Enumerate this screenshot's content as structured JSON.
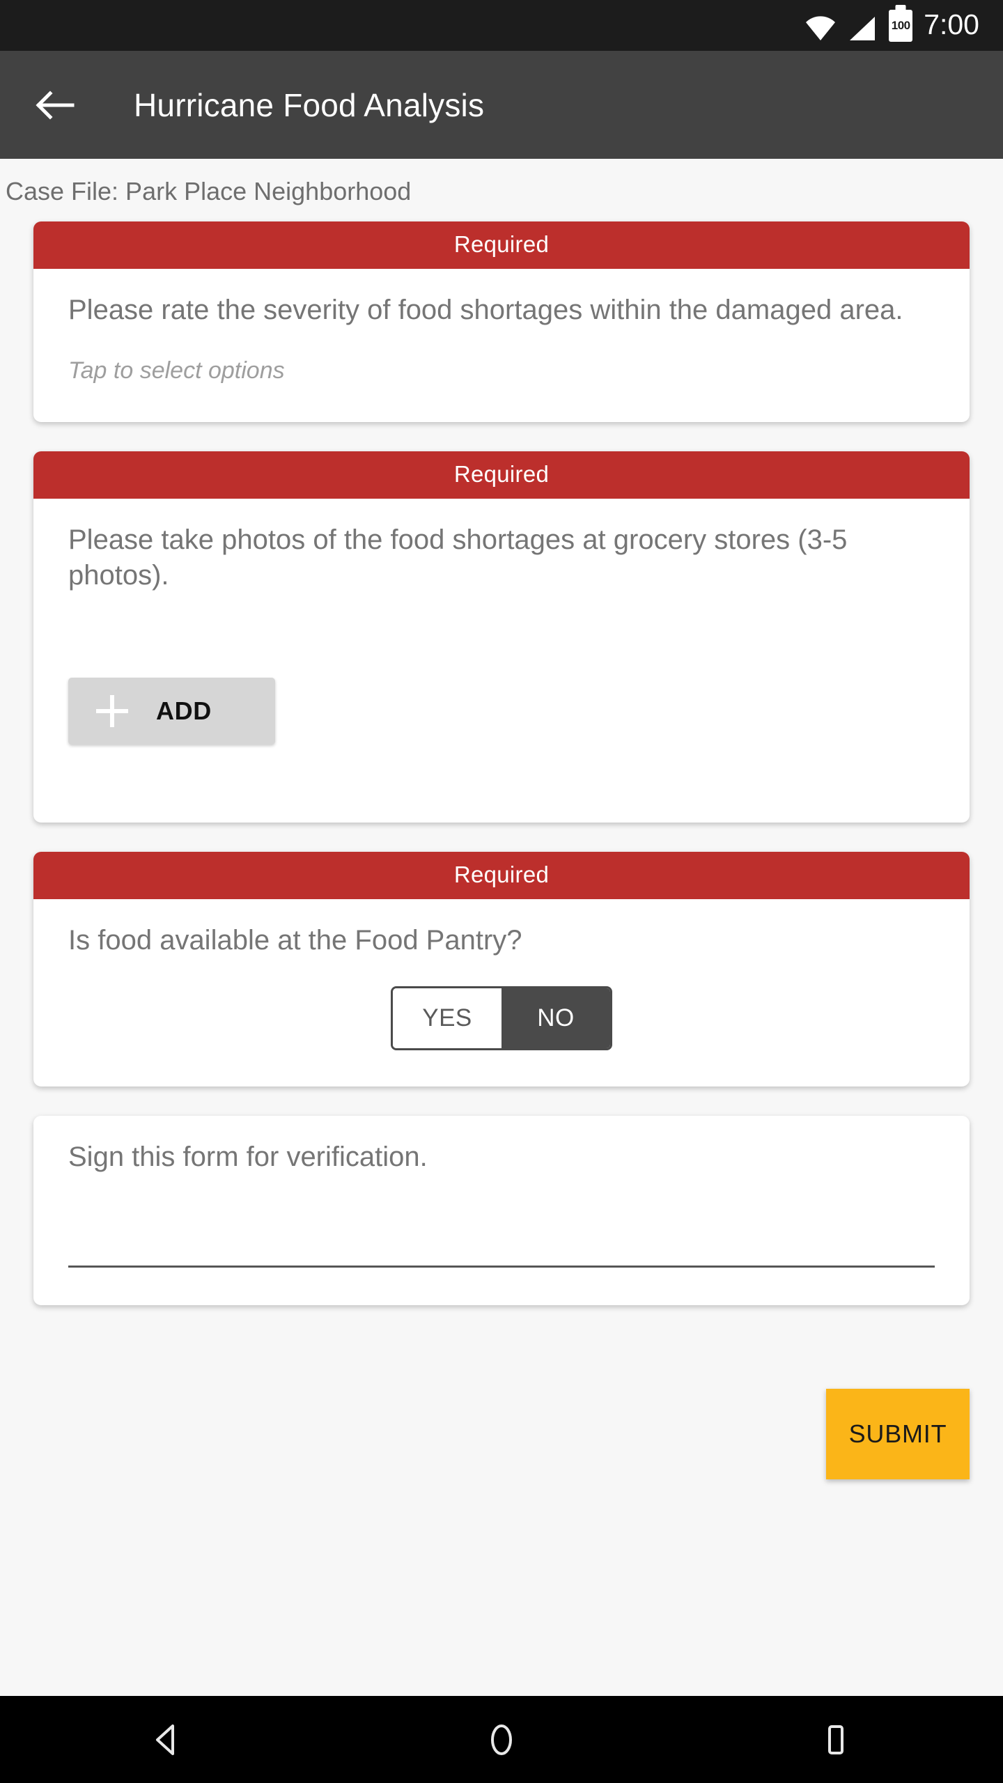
{
  "status_bar": {
    "wifi_icon": "wifi-icon",
    "signal_icon": "cellular-signal-icon",
    "battery_icon": "battery-icon",
    "battery_level": "100",
    "time": "7:00"
  },
  "app_bar": {
    "back_icon": "back-arrow-icon",
    "title": "Hurricane Food Analysis"
  },
  "subtitle": "Case File: Park Place Neighborhood",
  "cards": [
    {
      "banner": "Required",
      "question": "Please rate the severity of food shortages within the damaged area.",
      "hint": "Tap to select options"
    },
    {
      "banner": "Required",
      "question": "Please take photos of the food shortages at grocery stores (3-5 photos).",
      "add_label": "ADD",
      "add_icon": "plus-icon"
    },
    {
      "banner": "Required",
      "question": "Is food available at the Food Pantry?",
      "toggle": {
        "yes_label": "YES",
        "no_label": "NO",
        "selected": "NO"
      }
    },
    {
      "question": "Sign this form for verification."
    }
  ],
  "submit_label": "SUBMIT",
  "nav_bar": {
    "back_icon": "nav-back-triangle-icon",
    "home_icon": "nav-home-circle-icon",
    "recents_icon": "nav-recents-square-icon"
  },
  "colors": {
    "required_red": "#bc2f2c",
    "app_bar_gray": "#424242",
    "submit_amber": "#fbb518",
    "toggle_selected": "#4a4a4a",
    "page_background": "#f7f7f7",
    "add_button_gray": "#d6d6d6",
    "question_text": "#757575"
  }
}
